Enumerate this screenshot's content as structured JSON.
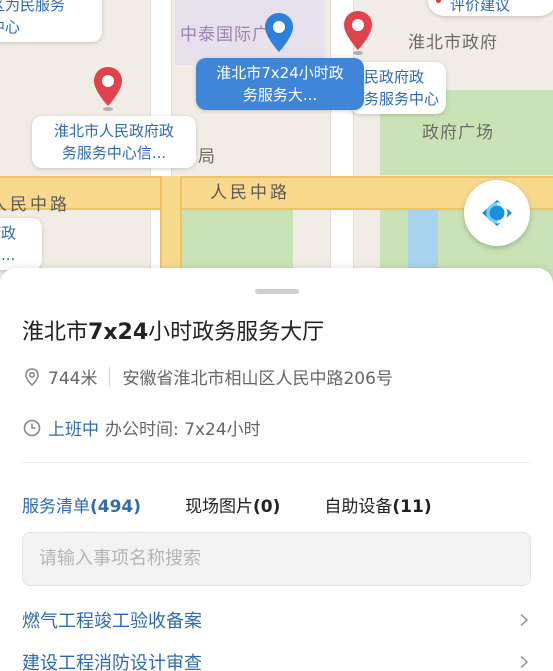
{
  "map": {
    "labels": {
      "top_left_callout": "区为民服务\n中心",
      "zhongtai_plaza": "中泰国际广场",
      "city_government": "淮北市政府",
      "government_square": "政府广场",
      "bureau_suffix": "局",
      "road_main": "人民中路",
      "road_left": "人民中路",
      "bottom_left_callout": "府政\n务..."
    },
    "callouts": {
      "active": "淮北市7x24小时政\n务服务大...",
      "left": "淮北市人民政府政\n务服务中心信...",
      "right": "民政府政\n务服务中心"
    },
    "eval_button": "评价建议"
  },
  "sheet": {
    "title_prefix": "淮北市",
    "title_bold": "7x24",
    "title_suffix": "小时政务服务大厅",
    "distance": "744米",
    "address": "安徽省淮北市相山区人民中路206号",
    "status": "上班中",
    "hours": "办公时间: 7x24小时",
    "tabs": [
      {
        "label": "服务清单",
        "count": "(494)"
      },
      {
        "label": "现场图片",
        "count": "(0)"
      },
      {
        "label": "自助设备",
        "count": "(11)"
      }
    ],
    "search_placeholder": "请输入事项名称搜索",
    "items": [
      "燃气工程竣工验收备案",
      "建设工程消防设计审查"
    ]
  },
  "colors": {
    "accent": "#2f6bb3",
    "active_callout": "#3f86d9",
    "pin_red": "#e0434b",
    "pin_blue": "#2f7fdc"
  }
}
